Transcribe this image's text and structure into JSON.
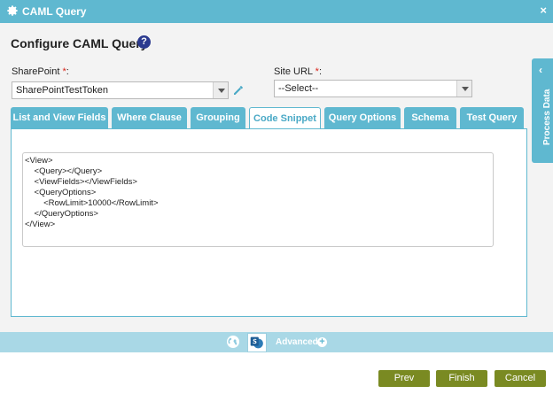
{
  "window": {
    "title": "CAML Query",
    "close_glyph": "×"
  },
  "heading": {
    "text": "Configure CAML Query",
    "help_glyph": "?"
  },
  "sharepoint": {
    "label": "SharePoint ",
    "required": "*",
    "colon": ":",
    "value": "SharePointTestToken"
  },
  "site_url": {
    "label": "Site URL ",
    "required": "*",
    "colon": ":",
    "value": "--Select--"
  },
  "tabs": [
    {
      "label": "List and View Fields"
    },
    {
      "label": "Where Clause"
    },
    {
      "label": "Grouping"
    },
    {
      "label": "Code Snippet",
      "active": true
    },
    {
      "label": "Query Options"
    },
    {
      "label": "Schema"
    },
    {
      "label": "Test Query"
    }
  ],
  "code_snippet": "<View>\n    <Query></Query>\n    <ViewFields></ViewFields>\n    <QueryOptions>\n        <RowLimit>10000</RowLimit>\n    </QueryOptions>\n</View>",
  "side_panel": {
    "label": "Process Data",
    "chevron": "‹"
  },
  "advanced": {
    "label": "Advanced",
    "plus": "+"
  },
  "buttons": {
    "prev": "Prev",
    "finish": "Finish",
    "cancel": "Cancel"
  },
  "colors": {
    "accent": "#5fb8d0",
    "button": "#7a8a22",
    "required": "#d9261c",
    "help": "#2b3a8f"
  }
}
